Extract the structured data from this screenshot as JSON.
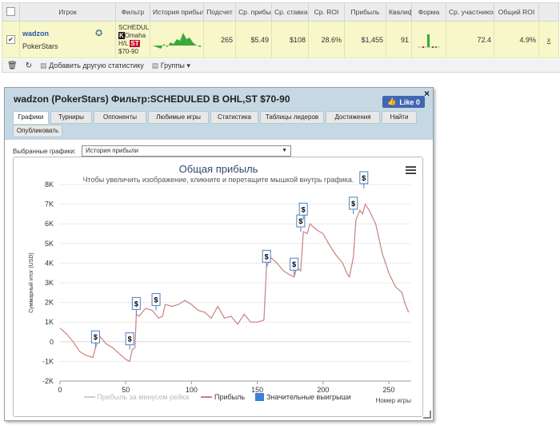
{
  "table": {
    "headers": [
      "",
      "Игрок",
      "Фильтр",
      "История прибыли",
      "Подсчет",
      "Ср. прибыль",
      "Ср. ставка",
      "Ср. ROI",
      "Прибыль",
      "Квалиф",
      "Форма",
      "Ср. участников",
      "Общий ROI",
      ""
    ],
    "row": {
      "player": "wadzon",
      "site": "PokerStars",
      "filter_lines": [
        "SCHEDUL",
        "Omaha",
        "H/L",
        "ST",
        "$70-90"
      ],
      "count": "265",
      "avg_profit": "$5.49",
      "avg_stake": "$108",
      "avg_roi": "28.6%",
      "profit": "$1,455",
      "qualif": "91",
      "avg_entrants": "72.4",
      "total_roi": "4.9%",
      "remove": "x"
    }
  },
  "toolbar": {
    "add_label": "Добавить другую статистику",
    "groups_label": "Группы"
  },
  "window": {
    "title": "wadzon (PokerStars) Фильтр:SCHEDULED В OHL,ST $70-90",
    "like_label": "Like 0",
    "close": "×",
    "tabs": [
      "Графики",
      "Турниры",
      "Оппоненты",
      "Любимые игры",
      "Статистика",
      "Таблицы лидеров",
      "Достижения",
      "Найти",
      "Опубликовать"
    ],
    "select_label": "Выбранные графики:",
    "select_value": "История прибыли"
  },
  "chart_data": {
    "type": "line",
    "title": "Общая прибыль",
    "subtitle": "Чтобы увеличить изображение, кликните и перетащите мышкой внутрь графика.",
    "xlabel": "Номер игры",
    "ylabel": "Суммарный итог (USD)",
    "xlim": [
      0,
      267
    ],
    "ylim": [
      -2000,
      8000
    ],
    "xticks": [
      0,
      50,
      100,
      150,
      200,
      250
    ],
    "ytick_labels": [
      "-2K",
      "-1K",
      "0",
      "1K",
      "2K",
      "3K",
      "4K",
      "5K",
      "6K",
      "7K",
      "8K"
    ],
    "yticks": [
      -2000,
      -1000,
      0,
      1000,
      2000,
      3000,
      4000,
      5000,
      6000,
      7000,
      8000
    ],
    "legend": [
      "Прибыль за минусом рейка",
      "Прибыль",
      "Значительные выигрыши"
    ],
    "series": [
      {
        "name": "Прибыль",
        "color": "#c8807f",
        "x": [
          0,
          5,
          10,
          15,
          20,
          25,
          27,
          30,
          35,
          40,
          45,
          50,
          53,
          55,
          57,
          58,
          60,
          65,
          70,
          75,
          78,
          80,
          85,
          90,
          95,
          100,
          105,
          110,
          115,
          120,
          125,
          130,
          135,
          140,
          145,
          150,
          155,
          157,
          160,
          165,
          170,
          175,
          178,
          180,
          183,
          185,
          188,
          190,
          195,
          200,
          205,
          210,
          215,
          218,
          220,
          223,
          225,
          228,
          230,
          232,
          235,
          240,
          245,
          250,
          255,
          260,
          262,
          265
        ],
        "y": [
          700,
          400,
          0,
          -500,
          -700,
          -800,
          -300,
          300,
          -100,
          -300,
          -600,
          -900,
          -1000,
          -400,
          -300,
          1400,
          1300,
          1700,
          1600,
          1200,
          1300,
          1900,
          1800,
          1900,
          2100,
          1900,
          1600,
          1500,
          1200,
          1800,
          1200,
          1300,
          900,
          1400,
          1000,
          1000,
          1100,
          3800,
          4300,
          4000,
          3600,
          3400,
          3300,
          3800,
          3600,
          5600,
          5500,
          6000,
          5700,
          5500,
          4900,
          4400,
          4000,
          3500,
          3300,
          4300,
          6200,
          6700,
          6500,
          7000,
          6700,
          6000,
          4500,
          3500,
          2800,
          2500,
          2000,
          1500
        ]
      }
    ],
    "markers": {
      "name": "Значительные выигрыши",
      "x": [
        27,
        53,
        58,
        73,
        157,
        178,
        183,
        185,
        223,
        231
      ],
      "y": [
        -300,
        -400,
        1400,
        1600,
        3800,
        3400,
        5600,
        6200,
        6500,
        7800
      ]
    }
  }
}
